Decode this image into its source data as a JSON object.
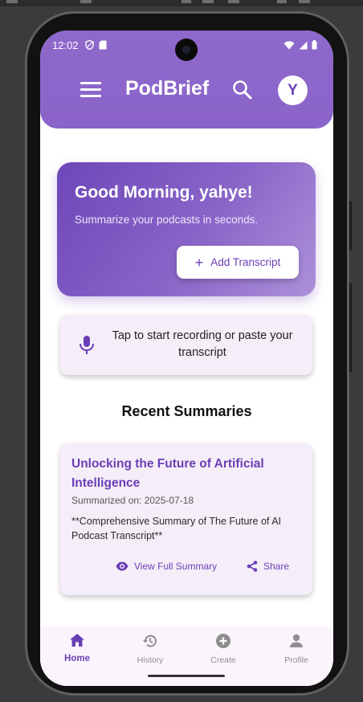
{
  "status_bar": {
    "time": "12:02"
  },
  "app": {
    "title": "PodBrief",
    "avatar_initial": "Y"
  },
  "hero": {
    "greeting": "Good Morning, yahye!",
    "subtitle": "Summarize your podcasts in seconds.",
    "button_label": "Add Transcript"
  },
  "record_prompt": {
    "text": "Tap to start recording or paste your transcript"
  },
  "recent": {
    "section_title": "Recent Summaries",
    "items": [
      {
        "title": "Unlocking the Future of Artificial Intelligence",
        "date": "Summarized on: 2025-07-18",
        "excerpt": "**Comprehensive Summary of The Future of AI Podcast Transcript**",
        "view_label": "View Full Summary",
        "share_label": "Share"
      }
    ]
  },
  "bottom_nav": {
    "items": [
      {
        "label": "Home",
        "icon": "home-icon",
        "active": true
      },
      {
        "label": "History",
        "icon": "history-icon",
        "active": false
      },
      {
        "label": "Create",
        "icon": "add-circle-icon",
        "active": false
      },
      {
        "label": "Profile",
        "icon": "person-icon",
        "active": false
      }
    ]
  },
  "colors": {
    "primary": "#6a3fb6",
    "header": "#8b64c9",
    "card_bg": "#f5eef8",
    "nav_bg": "#fbf4fc",
    "inactive": "#8e8e8e"
  }
}
